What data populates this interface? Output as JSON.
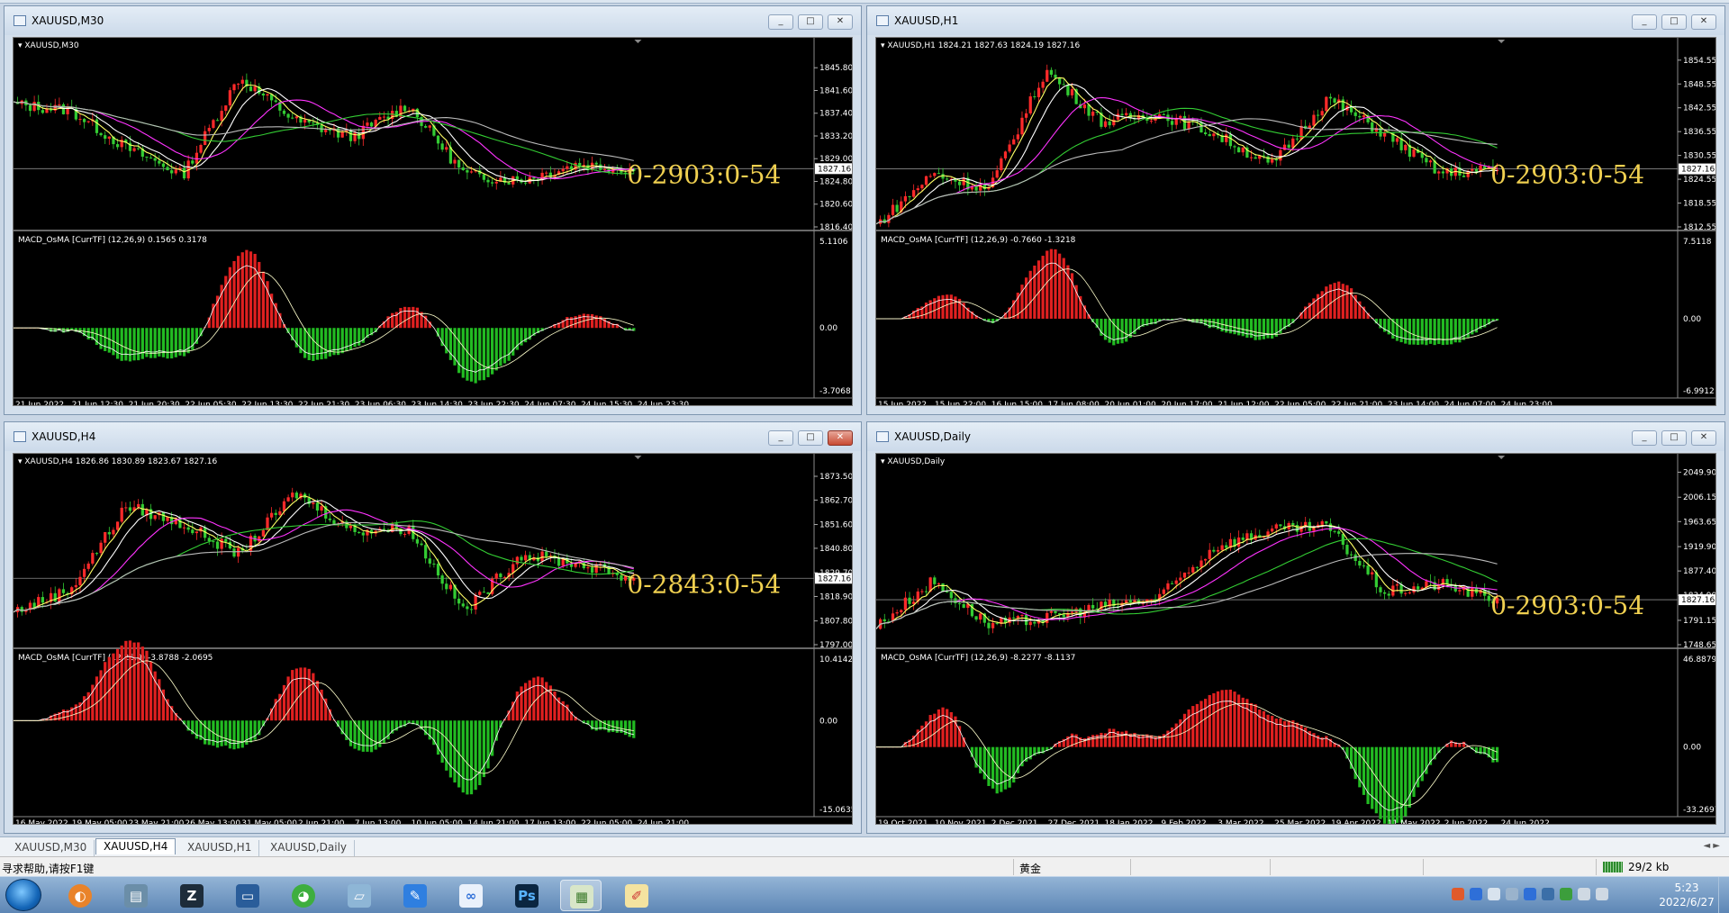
{
  "charts": [
    {
      "id": "m30",
      "window_title": "XAUUSD,M30",
      "chart_label": "XAUUSD,M30",
      "ohlc": "",
      "prices": [
        "1845.80",
        "1841.60",
        "1837.40",
        "1833.20",
        "1829.00",
        "1824.80",
        "1820.60",
        "1816.40"
      ],
      "current_price": "1827.16",
      "macd_label": "MACD_OsMA [CurrTF] (12,26,9) 0.1565 0.3178",
      "macd_scale": [
        "5.1106",
        "0.00",
        "-3.7068"
      ],
      "time_labels": [
        "21 Jun 2022",
        "21 Jun 12:30",
        "21 Jun 20:30",
        "22 Jun 05:30",
        "22 Jun 13:30",
        "22 Jun 21:30",
        "23 Jun 06:30",
        "23 Jun 14:30",
        "23 Jun 22:30",
        "24 Jun 07:30",
        "24 Jun 15:30",
        "24 Jun 23:30"
      ],
      "overlay": "0-2903:0-54",
      "close_style": "normal"
    },
    {
      "id": "h1",
      "window_title": "XAUUSD,H1",
      "chart_label": "XAUUSD,H1",
      "ohlc": "1824.21 1827.63 1824.19 1827.16",
      "prices": [
        "1854.55",
        "1848.55",
        "1842.55",
        "1836.55",
        "1830.55",
        "1824.55",
        "1818.55",
        "1812.55"
      ],
      "current_price": "1827.16",
      "macd_label": "MACD_OsMA [CurrTF] (12,26,9) -0.7660 -1.3218",
      "macd_scale": [
        "7.5118",
        "0.00",
        "-6.9912"
      ],
      "time_labels": [
        "15 Jun 2022",
        "15 Jun 22:00",
        "16 Jun 15:00",
        "17 Jun 08:00",
        "20 Jun 01:00",
        "20 Jun 17:00",
        "21 Jun 12:00",
        "22 Jun 05:00",
        "22 Jun 21:00",
        "23 Jun 14:00",
        "24 Jun 07:00",
        "24 Jun 23:00"
      ],
      "overlay": "0-2903:0-54",
      "close_style": "normal"
    },
    {
      "id": "h4",
      "window_title": "XAUUSD,H4",
      "chart_label": "XAUUSD,H4",
      "ohlc": "1826.86 1830.89 1823.67 1827.16",
      "prices": [
        "1873.50",
        "1862.70",
        "1851.60",
        "1840.80",
        "1829.70",
        "1818.90",
        "1807.80",
        "1797.00"
      ],
      "current_price": "1827.16",
      "macd_label": "MACD_OsMA [CurrTF] (12,26,9) -3.8788 -2.0695",
      "macd_scale": [
        "10.4142",
        "0.00",
        "-15.0635"
      ],
      "time_labels": [
        "16 May 2022",
        "19 May 05:00",
        "23 May 21:00",
        "26 May 13:00",
        "31 May 05:00",
        "2 Jun 21:00",
        "7 Jun 13:00",
        "10 Jun 05:00",
        "14 Jun 21:00",
        "17 Jun 13:00",
        "22 Jun 05:00",
        "24 Jun 21:00"
      ],
      "overlay": "0-2843:0-54",
      "close_style": "red"
    },
    {
      "id": "daily",
      "window_title": "XAUUSD,Daily",
      "chart_label": "XAUUSD,Daily",
      "ohlc": "",
      "prices": [
        "2049.90",
        "2006.15",
        "1963.65",
        "1919.90",
        "1877.40",
        "1834.90",
        "1791.15",
        "1748.65"
      ],
      "current_price": "1827.16",
      "macd_label": "MACD_OsMA [CurrTF] (12,26,9) -8.2277 -8.1137",
      "macd_scale": [
        "46.8879",
        "0.00",
        "-33.2697"
      ],
      "time_labels": [
        "19 Oct 2021",
        "10 Nov 2021",
        "2 Dec 2021",
        "27 Dec 2021",
        "18 Jan 2022",
        "9 Feb 2022",
        "3 Mar 2022",
        "25 Mar 2022",
        "19 Apr 2022",
        "11 May 2022",
        "2 Jun 2022",
        "24 Jun 2022"
      ],
      "overlay": "0-2903:0-54",
      "close_style": "normal"
    }
  ],
  "chart_data": [
    {
      "type": "line",
      "title": "XAUUSD,M30",
      "x": [
        "21 Jun 2022",
        "21 Jun 12:30",
        "21 Jun 20:30",
        "22 Jun 05:30",
        "22 Jun 13:30",
        "22 Jun 21:30",
        "23 Jun 06:30",
        "23 Jun 14:30",
        "23 Jun 22:30",
        "24 Jun 07:30",
        "24 Jun 15:30",
        "24 Jun 23:30"
      ],
      "series": [
        {
          "name": "",
          "values": [
            1839,
            1838,
            1831,
            1826,
            1844,
            1836,
            1833,
            1839,
            1826,
            1825,
            1828,
            1827
          ]
        }
      ],
      "ylim": [
        1816.4,
        1849
      ]
    },
    {
      "type": "line",
      "title": "XAUUSD,H1",
      "x": [
        "15 Jun 2022",
        "15 Jun 22:00",
        "16 Jun 15:00",
        "17 Jun 08:00",
        "20 Jun 01:00",
        "20 Jun 17:00",
        "21 Jun 12:00",
        "22 Jun 05:00",
        "22 Jun 21:00",
        "23 Jun 14:00",
        "24 Jun 07:00",
        "24 Jun 23:00"
      ],
      "series": [
        {
          "name": "",
          "values": [
            1813,
            1826,
            1822,
            1852,
            1839,
            1841,
            1836,
            1828,
            1845,
            1836,
            1826,
            1827
          ]
        }
      ],
      "ylim": [
        1812.55,
        1857
      ]
    },
    {
      "type": "line",
      "title": "XAUUSD,H4",
      "x": [
        "16 May 2022",
        "19 May 05:00",
        "23 May 21:00",
        "26 May 13:00",
        "31 May 05:00",
        "2 Jun 21:00",
        "7 Jun 13:00",
        "10 Jun 05:00",
        "14 Jun 21:00",
        "17 Jun 13:00",
        "22 Jun 05:00",
        "24 Jun 21:00"
      ],
      "series": [
        {
          "name": "",
          "values": [
            1812,
            1822,
            1860,
            1852,
            1838,
            1866,
            1849,
            1850,
            1812,
            1838,
            1834,
            1827
          ]
        }
      ],
      "ylim": [
        1797,
        1878
      ]
    },
    {
      "type": "line",
      "title": "XAUUSD,Daily",
      "x": [
        "19 Oct 2021",
        "10 Nov 2021",
        "2 Dec 2021",
        "27 Dec 2021",
        "18 Jan 2022",
        "9 Feb 2022",
        "3 Mar 2022",
        "25 Mar 2022",
        "19 Apr 2022",
        "11 May 2022",
        "2 Jun 2022",
        "24 Jun 2022"
      ],
      "series": [
        {
          "name": "",
          "values": [
            1780,
            1860,
            1783,
            1795,
            1815,
            1830,
            1920,
            1948,
            1955,
            1840,
            1855,
            1827
          ]
        }
      ],
      "ylim": [
        1748.65,
        2060
      ]
    }
  ],
  "tabs": [
    "XAUUSD,M30",
    "XAUUSD,H4",
    "XAUUSD,H1",
    "XAUUSD,Daily"
  ],
  "active_tab": 1,
  "status": {
    "help": "寻求帮助,请按F1键",
    "symbol": "黄金",
    "traffic": "29/2 kb"
  },
  "taskbar": {
    "apps": [
      "browser",
      "sim",
      "zalgo",
      "monitor",
      "wechat",
      "notes",
      "feather",
      "baidu-netdisk",
      "photoshop",
      "metatrader",
      "paint"
    ],
    "active_app": "metatrader",
    "time": "5:23",
    "date": "2022/6/27"
  }
}
